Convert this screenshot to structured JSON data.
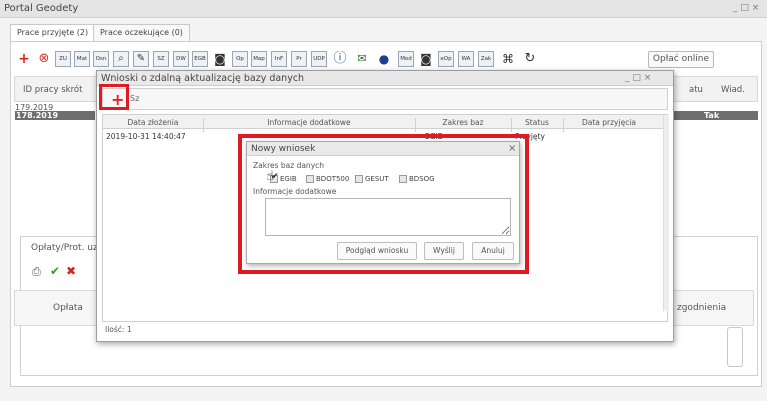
{
  "window": {
    "title": "Portal Geodety",
    "controls": "_ □ ×"
  },
  "tabs": [
    {
      "label": "Prace przyjęte (2)"
    },
    {
      "label": "Prace oczekujące (0)"
    }
  ],
  "toolbar": {
    "icons": [
      "plus-icon",
      "stop-icon",
      "zu",
      "mat",
      "osn",
      "search-doc",
      "edit-doc",
      "sz",
      "dw",
      "egb",
      "camera",
      "op",
      "map",
      "inf",
      "pr",
      "udp",
      "info",
      "sms",
      "chat",
      "mod",
      "photo",
      "eop",
      "wa",
      "zak",
      "binoculars",
      "refresh"
    ],
    "tiny_labels": {
      "zu": "ZU",
      "mat": "Mat",
      "osn": "Osn",
      "sz": "SZ",
      "dw": "DW",
      "egb": "EGB",
      "op": "Op",
      "map": "Map",
      "inf": "InF",
      "pr": "Pr",
      "udp": "UDP",
      "mod": "Mod",
      "eop": "eOp",
      "wa": "WA",
      "zak": "Zak"
    },
    "pay_button": "Opłać online"
  },
  "main_grid": {
    "headers": {
      "id": "ID pracy skrót",
      "status": "atu",
      "wiad": "Wiad."
    },
    "rows": [
      {
        "id": "179.2019",
        "wiad": ""
      },
      {
        "id": "178.2019",
        "wiad": "Tak"
      }
    ]
  },
  "lower_panel": {
    "title": "Opłaty/Prot. uz",
    "column_oplata": "Opłata",
    "column_uzgodnienia": "zgodnienia"
  },
  "modal_requests": {
    "title": "Wnioski o zdalną aktualizację bazy danych",
    "controls": "_ □ ×",
    "tool_partial": "Sz",
    "columns": [
      "Data złożenia",
      "Informacje dodatkowe",
      "Zakres baz",
      "Status",
      "Data przyjęcia"
    ],
    "rows": [
      {
        "date": "2019-10-31 14:40:47",
        "info": "",
        "scope": "EGIB",
        "status": "Przyjęty",
        "accepted": ""
      }
    ],
    "footer": "Ilość: 1"
  },
  "modal_new": {
    "title": "Nowy wniosek",
    "close": "×",
    "scope_label": "Zakres baz danych",
    "checkboxes": [
      {
        "label": "EGIB",
        "checked": true
      },
      {
        "label": "BDOT500",
        "checked": false
      },
      {
        "label": "GESUT",
        "checked": false
      },
      {
        "label": "BDSOG",
        "checked": false
      }
    ],
    "info_label": "Informacje dodatkowe",
    "textarea_value": "",
    "buttons": {
      "preview": "Podgląd wniosku",
      "send": "Wyślij",
      "cancel": "Anuluj"
    }
  },
  "colors": {
    "highlight": "#e01a22",
    "add_red": "#e0261c",
    "check_green": "#3a9a2a",
    "selected_row": "#6e6e6e"
  }
}
